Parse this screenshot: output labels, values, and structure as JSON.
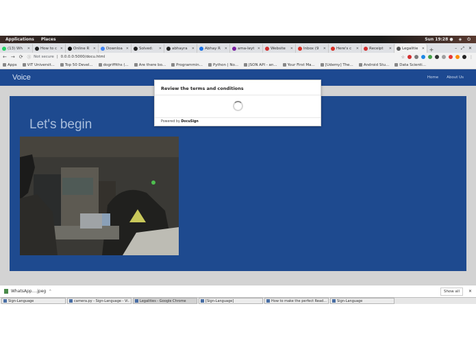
{
  "gnome": {
    "applications": "Applications",
    "places": "Places",
    "clock": "Sun 19:28 ●"
  },
  "tabs": [
    {
      "label": "(13) Wh",
      "color": "#25d366"
    },
    {
      "label": "How to c",
      "color": "#222222"
    },
    {
      "label": "Online R",
      "color": "#111111"
    },
    {
      "label": "Downloa",
      "color": "#4285f4"
    },
    {
      "label": "Solved:",
      "color": "#222222"
    },
    {
      "label": "abhayra",
      "color": "#222222"
    },
    {
      "label": "Abhay R",
      "color": "#1a73e8"
    },
    {
      "label": "ama-leyt",
      "color": "#7b1fa2"
    },
    {
      "label": "Website",
      "color": "#d32f2f"
    },
    {
      "label": "Inbox (9",
      "color": "#d93025"
    },
    {
      "label": "Here's c",
      "color": "#d93025"
    },
    {
      "label": "Receipt",
      "color": "#d32f2f"
    },
    {
      "label": "Legalitie",
      "color": "#555555",
      "active": true
    }
  ],
  "omnibar": {
    "secure_label": "Not secure",
    "url": "0.0.0.0:5000/docu.html"
  },
  "bookmarks": [
    "Apps",
    "VIT Universit...",
    "Top 50 Devel...",
    "dogriffiths (...",
    "Are there bo...",
    "Programmin...",
    "Python | No...",
    "JSON API - an...",
    "Your First Ma...",
    "[Udemy] The...",
    "Android Stu...",
    "Data Scienti..."
  ],
  "site": {
    "brand": "Voice",
    "nav": [
      "Home",
      "About Us"
    ],
    "heading": "Let's begin"
  },
  "modal": {
    "title": "Review the terms and conditions",
    "powered_prefix": "Powered by ",
    "powered_brand": "DocuSign"
  },
  "downloads": {
    "file": "WhatsApp....jpeg",
    "show_all": "Show all"
  },
  "taskbar": [
    {
      "label": "Sign-Language"
    },
    {
      "label": "camera.py - Sign-Language - Vi..."
    },
    {
      "label": "Legalities - Google Chrome",
      "active": true
    },
    {
      "label": "[Sign-Language]"
    },
    {
      "label": "How to make the perfect Read..."
    },
    {
      "label": "Sign-Language"
    }
  ]
}
